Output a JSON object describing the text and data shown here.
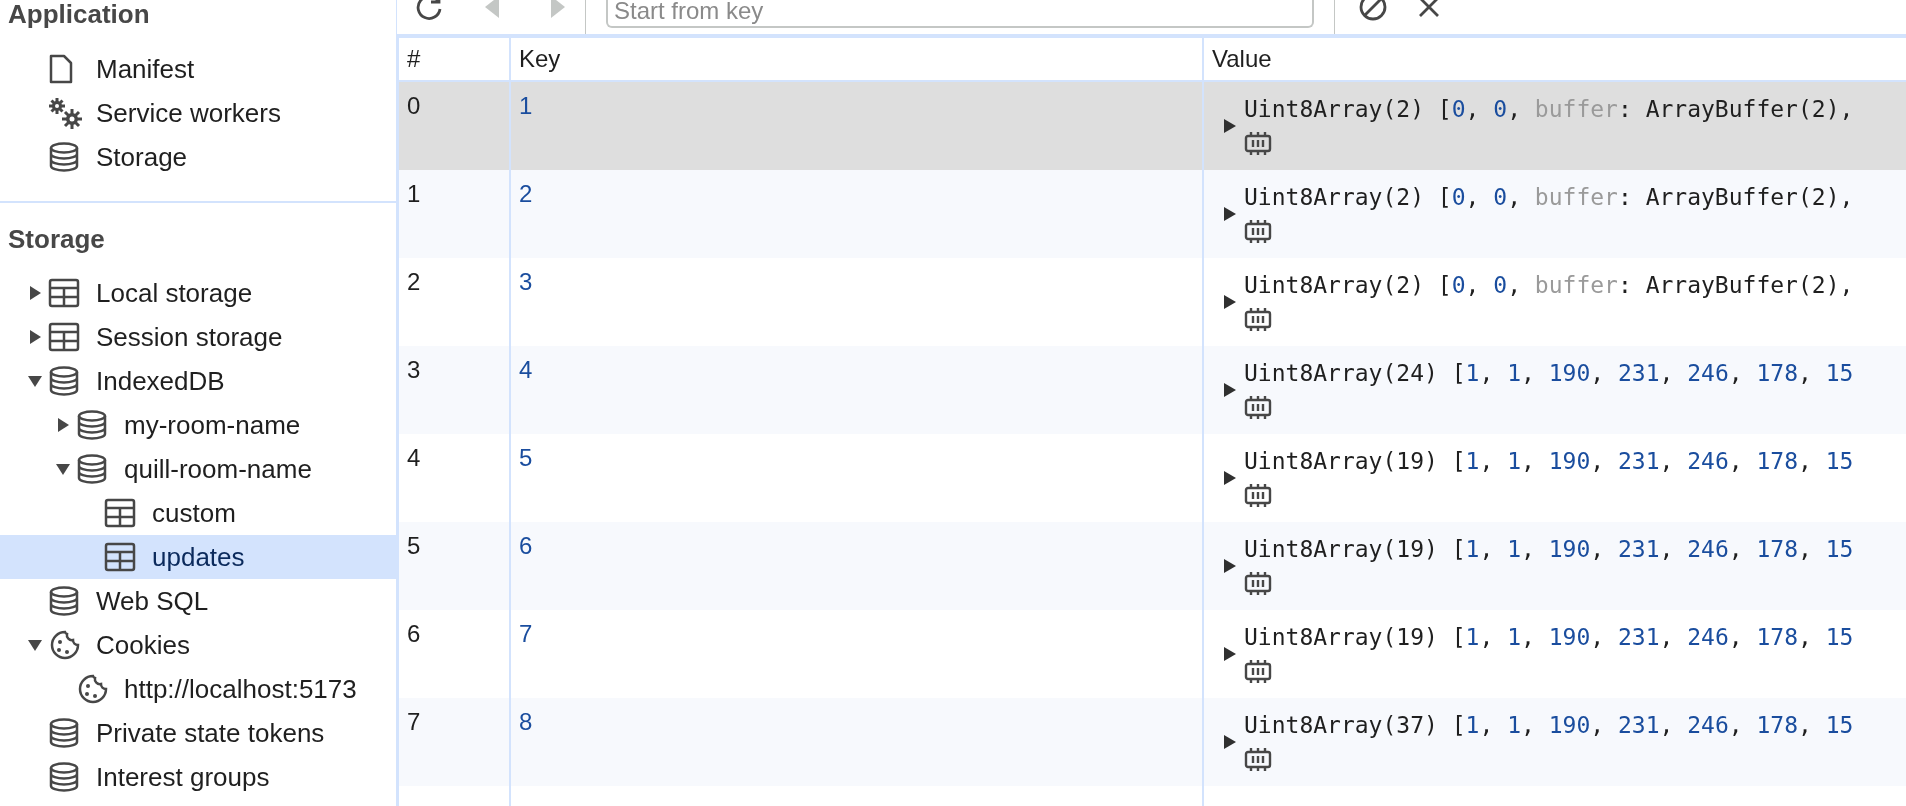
{
  "toolbar": {
    "buttons": [
      {
        "kind": "refresh",
        "disabled": false
      },
      {
        "kind": "previous",
        "disabled": true
      },
      {
        "kind": "next",
        "disabled": true
      }
    ],
    "search": {
      "placeholder": "Start from key"
    },
    "actions": [
      {
        "kind": "clear",
        "disabled": false
      },
      {
        "kind": "delete",
        "disabled": false
      }
    ]
  },
  "sidebar": {
    "sections": [
      {
        "title": "Application",
        "items": [
          {
            "label": "Manifest",
            "kind": "file",
            "selected": false
          },
          {
            "label": "Service workers",
            "kind": "gears",
            "selected": false
          },
          {
            "label": "Storage",
            "kind": "database",
            "selected": false
          }
        ]
      },
      {
        "title": "Storage",
        "items": [
          {
            "label": "Local storage",
            "kind": "table",
            "selected": false,
            "expanded": false
          },
          {
            "label": "Session storage",
            "kind": "table",
            "selected": false,
            "expanded": false
          },
          {
            "label": "IndexedDB",
            "kind": "database",
            "selected": false,
            "expanded": true,
            "children": [
              {
                "label": "my-room-name",
                "kind": "database",
                "selected": false,
                "expanded": false
              },
              {
                "label": "quill-room-name",
                "kind": "database",
                "selected": false,
                "expanded": true,
                "children": [
                  {
                    "label": "custom",
                    "kind": "table",
                    "selected": false
                  },
                  {
                    "label": "updates",
                    "kind": "table",
                    "selected": true
                  }
                ]
              }
            ]
          },
          {
            "label": "Web SQL",
            "kind": "database",
            "selected": false
          },
          {
            "label": "Cookies",
            "kind": "cookie",
            "selected": false,
            "expanded": true,
            "children": [
              {
                "label": "http://localhost:5173",
                "kind": "cookie",
                "selected": false
              }
            ]
          },
          {
            "label": "Private state tokens",
            "kind": "database",
            "selected": false
          },
          {
            "label": "Interest groups",
            "kind": "database",
            "selected": false
          }
        ]
      }
    ]
  },
  "table": {
    "columns": [
      "#",
      "Key",
      "Value"
    ],
    "rows": [
      {
        "index": "0",
        "key": "1",
        "selected": true,
        "value": [
          {
            "kind": "plain",
            "text": "Uint8Array(2) ["
          },
          {
            "kind": "number",
            "text": "0"
          },
          {
            "kind": "plain",
            "text": ", "
          },
          {
            "kind": "number",
            "text": "0"
          },
          {
            "kind": "plain",
            "text": ", "
          },
          {
            "kind": "property",
            "text": "buffer"
          },
          {
            "kind": "plain",
            "text": ": ArrayBuffer(2),"
          }
        ]
      },
      {
        "index": "1",
        "key": "2",
        "selected": false,
        "value": [
          {
            "kind": "plain",
            "text": "Uint8Array(2) ["
          },
          {
            "kind": "number",
            "text": "0"
          },
          {
            "kind": "plain",
            "text": ", "
          },
          {
            "kind": "number",
            "text": "0"
          },
          {
            "kind": "plain",
            "text": ", "
          },
          {
            "kind": "property",
            "text": "buffer"
          },
          {
            "kind": "plain",
            "text": ": ArrayBuffer(2),"
          }
        ]
      },
      {
        "index": "2",
        "key": "3",
        "selected": false,
        "value": [
          {
            "kind": "plain",
            "text": "Uint8Array(2) ["
          },
          {
            "kind": "number",
            "text": "0"
          },
          {
            "kind": "plain",
            "text": ", "
          },
          {
            "kind": "number",
            "text": "0"
          },
          {
            "kind": "plain",
            "text": ", "
          },
          {
            "kind": "property",
            "text": "buffer"
          },
          {
            "kind": "plain",
            "text": ": ArrayBuffer(2),"
          }
        ]
      },
      {
        "index": "3",
        "key": "4",
        "selected": false,
        "value": [
          {
            "kind": "plain",
            "text": "Uint8Array(24) ["
          },
          {
            "kind": "number",
            "text": "1"
          },
          {
            "kind": "plain",
            "text": ", "
          },
          {
            "kind": "number",
            "text": "1"
          },
          {
            "kind": "plain",
            "text": ", "
          },
          {
            "kind": "number",
            "text": "190"
          },
          {
            "kind": "plain",
            "text": ", "
          },
          {
            "kind": "number",
            "text": "231"
          },
          {
            "kind": "plain",
            "text": ", "
          },
          {
            "kind": "number",
            "text": "246"
          },
          {
            "kind": "plain",
            "text": ", "
          },
          {
            "kind": "number",
            "text": "178"
          },
          {
            "kind": "plain",
            "text": ", "
          },
          {
            "kind": "number",
            "text": "15"
          }
        ]
      },
      {
        "index": "4",
        "key": "5",
        "selected": false,
        "value": [
          {
            "kind": "plain",
            "text": "Uint8Array(19) ["
          },
          {
            "kind": "number",
            "text": "1"
          },
          {
            "kind": "plain",
            "text": ", "
          },
          {
            "kind": "number",
            "text": "1"
          },
          {
            "kind": "plain",
            "text": ", "
          },
          {
            "kind": "number",
            "text": "190"
          },
          {
            "kind": "plain",
            "text": ", "
          },
          {
            "kind": "number",
            "text": "231"
          },
          {
            "kind": "plain",
            "text": ", "
          },
          {
            "kind": "number",
            "text": "246"
          },
          {
            "kind": "plain",
            "text": ", "
          },
          {
            "kind": "number",
            "text": "178"
          },
          {
            "kind": "plain",
            "text": ", "
          },
          {
            "kind": "number",
            "text": "15"
          }
        ]
      },
      {
        "index": "5",
        "key": "6",
        "selected": false,
        "value": [
          {
            "kind": "plain",
            "text": "Uint8Array(19) ["
          },
          {
            "kind": "number",
            "text": "1"
          },
          {
            "kind": "plain",
            "text": ", "
          },
          {
            "kind": "number",
            "text": "1"
          },
          {
            "kind": "plain",
            "text": ", "
          },
          {
            "kind": "number",
            "text": "190"
          },
          {
            "kind": "plain",
            "text": ", "
          },
          {
            "kind": "number",
            "text": "231"
          },
          {
            "kind": "plain",
            "text": ", "
          },
          {
            "kind": "number",
            "text": "246"
          },
          {
            "kind": "plain",
            "text": ", "
          },
          {
            "kind": "number",
            "text": "178"
          },
          {
            "kind": "plain",
            "text": ", "
          },
          {
            "kind": "number",
            "text": "15"
          }
        ]
      },
      {
        "index": "6",
        "key": "7",
        "selected": false,
        "value": [
          {
            "kind": "plain",
            "text": "Uint8Array(19) ["
          },
          {
            "kind": "number",
            "text": "1"
          },
          {
            "kind": "plain",
            "text": ", "
          },
          {
            "kind": "number",
            "text": "1"
          },
          {
            "kind": "plain",
            "text": ", "
          },
          {
            "kind": "number",
            "text": "190"
          },
          {
            "kind": "plain",
            "text": ", "
          },
          {
            "kind": "number",
            "text": "231"
          },
          {
            "kind": "plain",
            "text": ", "
          },
          {
            "kind": "number",
            "text": "246"
          },
          {
            "kind": "plain",
            "text": ", "
          },
          {
            "kind": "number",
            "text": "178"
          },
          {
            "kind": "plain",
            "text": ", "
          },
          {
            "kind": "number",
            "text": "15"
          }
        ]
      },
      {
        "index": "7",
        "key": "8",
        "selected": false,
        "value": [
          {
            "kind": "plain",
            "text": "Uint8Array(37) ["
          },
          {
            "kind": "number",
            "text": "1"
          },
          {
            "kind": "plain",
            "text": ", "
          },
          {
            "kind": "number",
            "text": "1"
          },
          {
            "kind": "plain",
            "text": ", "
          },
          {
            "kind": "number",
            "text": "190"
          },
          {
            "kind": "plain",
            "text": ", "
          },
          {
            "kind": "number",
            "text": "231"
          },
          {
            "kind": "plain",
            "text": ", "
          },
          {
            "kind": "number",
            "text": "246"
          },
          {
            "kind": "plain",
            "text": ", "
          },
          {
            "kind": "number",
            "text": "178"
          },
          {
            "kind": "plain",
            "text": ", "
          },
          {
            "kind": "number",
            "text": "15"
          }
        ]
      }
    ]
  }
}
